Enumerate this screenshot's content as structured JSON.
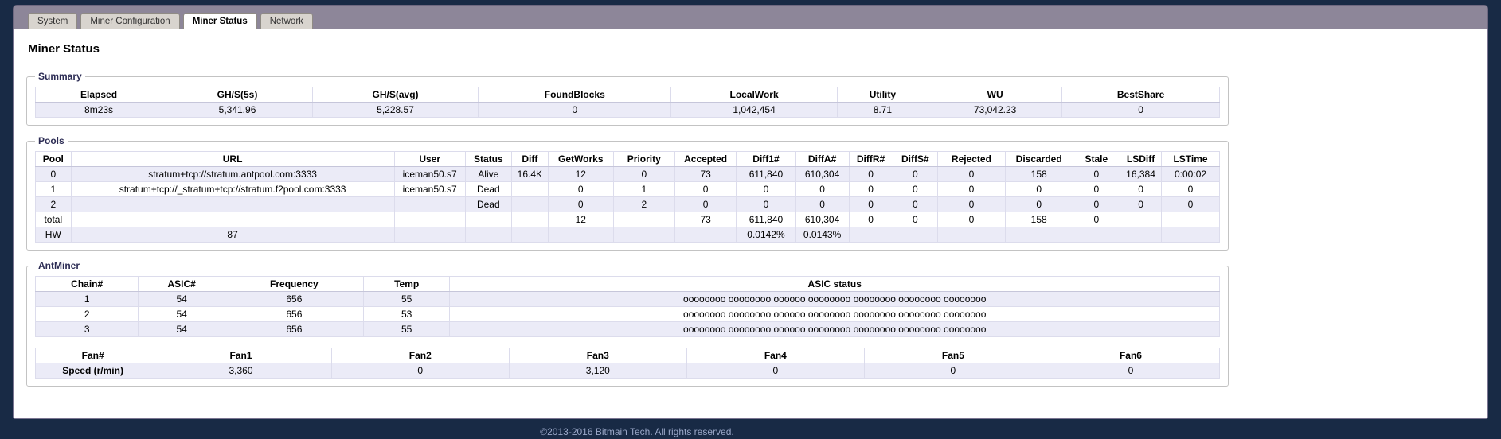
{
  "page": {
    "title": "Miner Status"
  },
  "tabs": [
    {
      "label": "System"
    },
    {
      "label": "Miner Configuration"
    },
    {
      "label": "Miner Status"
    },
    {
      "label": "Network"
    }
  ],
  "sections": {
    "summary_legend": "Summary",
    "pools_legend": "Pools",
    "antminer_legend": "AntMiner"
  },
  "tables": {
    "summary": {
      "headers": [
        "Elapsed",
        "GH/S(5s)",
        "GH/S(avg)",
        "FoundBlocks",
        "LocalWork",
        "Utility",
        "WU",
        "BestShare"
      ],
      "rows": [
        [
          "8m23s",
          "5,341.96",
          "5,228.57",
          "0",
          "1,042,454",
          "8.71",
          "73,042.23",
          "0"
        ]
      ]
    },
    "pools": {
      "headers": [
        "Pool",
        "URL",
        "User",
        "Status",
        "Diff",
        "GetWorks",
        "Priority",
        "Accepted",
        "Diff1#",
        "DiffA#",
        "DiffR#",
        "DiffS#",
        "Rejected",
        "Discarded",
        "Stale",
        "LSDiff",
        "LSTime"
      ],
      "rows": [
        [
          "0",
          "stratum+tcp://stratum.antpool.com:3333",
          "iceman50.s7",
          "Alive",
          "16.4K",
          "12",
          "0",
          "73",
          "611,840",
          "610,304",
          "0",
          "0",
          "0",
          "158",
          "0",
          "16,384",
          "0:00:02"
        ],
        [
          "1",
          "stratum+tcp://_stratum+tcp://stratum.f2pool.com:3333",
          "iceman50.s7",
          "Dead",
          "",
          "0",
          "1",
          "0",
          "0",
          "0",
          "0",
          "0",
          "0",
          "0",
          "0",
          "0",
          "0"
        ],
        [
          "2",
          "",
          "",
          "Dead",
          "",
          "0",
          "2",
          "0",
          "0",
          "0",
          "0",
          "0",
          "0",
          "0",
          "0",
          "0",
          "0"
        ],
        [
          "total",
          "",
          "",
          "",
          "",
          "12",
          "",
          "73",
          "611,840",
          "610,304",
          "0",
          "0",
          "0",
          "158",
          "0",
          "",
          ""
        ],
        [
          "HW",
          "87",
          "",
          "",
          "",
          "",
          "",
          "",
          "0.0142%",
          "0.0143%",
          "",
          "",
          "",
          "",
          "",
          "",
          ""
        ]
      ]
    },
    "chains": {
      "headers": [
        "Chain#",
        "ASIC#",
        "Frequency",
        "Temp",
        "ASIC status"
      ],
      "rows": [
        [
          "1",
          "54",
          "656",
          "55",
          "oooooooo oooooooo oooooo oooooooo oooooooo oooooooo oooooooo"
        ],
        [
          "2",
          "54",
          "656",
          "53",
          "oooooooo oooooooo oooooo oooooooo oooooooo oooooooo oooooooo"
        ],
        [
          "3",
          "54",
          "656",
          "55",
          "oooooooo oooooooo oooooo oooooooo oooooooo oooooooo oooooooo"
        ]
      ]
    },
    "fans": {
      "headers": [
        "Fan#",
        "Fan1",
        "Fan2",
        "Fan3",
        "Fan4",
        "Fan5",
        "Fan6"
      ],
      "rows": [
        [
          "Speed (r/min)",
          "3,360",
          "0",
          "3,120",
          "0",
          "0",
          "0"
        ]
      ]
    }
  },
  "footer": {
    "text": "©2013-2016 Bitmain Tech. All rights reserved."
  },
  "colors": {
    "page_background": "#182a45",
    "tab_band": "#8d8699",
    "row_stripe": "#ebebf7",
    "panel_background": "#ffffff"
  }
}
